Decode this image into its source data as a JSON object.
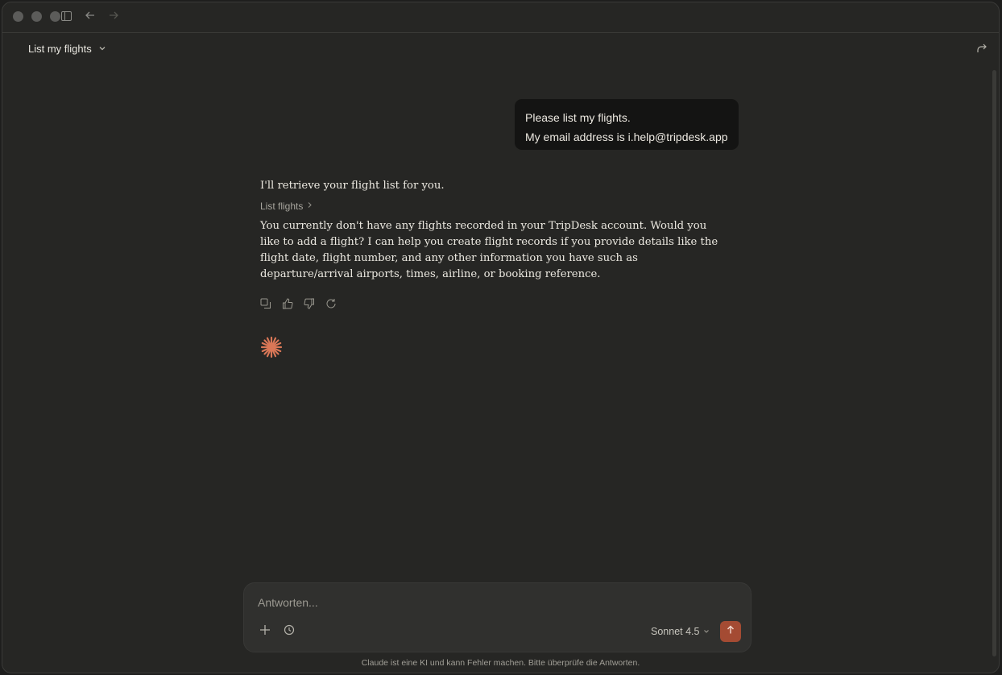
{
  "header": {
    "conversation_title": "List my flights"
  },
  "messages": {
    "user": {
      "line1": "Please list my flights.",
      "line2": "My email address is i.help@tripdesk.app"
    },
    "assistant": {
      "intro": "I'll retrieve your flight list for you.",
      "tool_call_label": "List flights",
      "body": "You currently don't have any flights recorded in your TripDesk account. Would you like to add a flight? I can help you create flight records if you provide details like the flight date, flight number, and any other information you have such as departure/arrival airports, times, airline, or booking reference."
    }
  },
  "composer": {
    "placeholder": "Antworten...",
    "model": "Sonnet 4.5"
  },
  "footer": {
    "disclaimer": "Claude ist eine KI und kann Fehler machen. Bitte überprüfe die Antworten."
  },
  "colors": {
    "accent": "#d97757",
    "send_button": "#a44b33",
    "background": "#262624"
  },
  "icons": [
    "sidebar-toggle-icon",
    "back-arrow-icon",
    "forward-arrow-icon",
    "chevron-down-icon",
    "share-icon",
    "copy-icon",
    "thumbs-up-icon",
    "thumbs-down-icon",
    "retry-icon",
    "claude-spark-icon",
    "plus-icon",
    "history-icon",
    "arrow-up-icon"
  ]
}
